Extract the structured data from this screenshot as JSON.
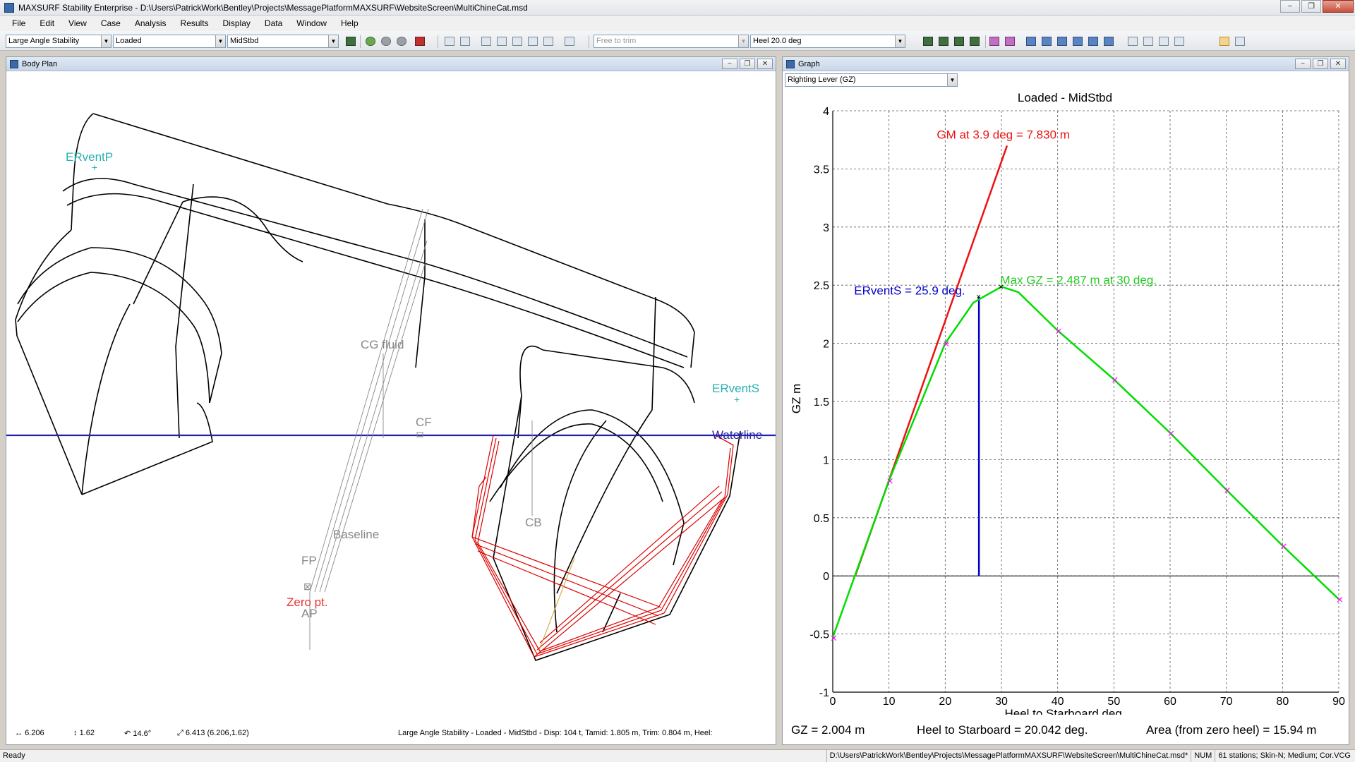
{
  "window": {
    "title": "MAXSURF Stability Enterprise - D:\\Users\\PatrickWork\\Bentley\\Projects\\MessagePlatformMAXSURF\\WebsiteScreen\\MultiChineCat.msd",
    "minimize": "−",
    "maximize": "❐",
    "close": "✕"
  },
  "menu": [
    "File",
    "Edit",
    "View",
    "Case",
    "Analysis",
    "Results",
    "Display",
    "Data",
    "Window",
    "Help"
  ],
  "toolbar": {
    "analysis_type": "Large Angle Stability",
    "loadcase": "Loaded",
    "fluid_mode": "MidStbd",
    "trim_mode": "Free to trim",
    "heel": "Heel 20.0 deg"
  },
  "body_plan": {
    "title": "Body Plan",
    "labels": {
      "ervent_p": "ERventP",
      "ervent_s": "ERventS",
      "cg_fluid": "CG fluid",
      "cf": "CF",
      "waterline": "Waterline",
      "cb": "CB",
      "baseline": "Baseline",
      "fp": "FP",
      "zero_pt": "Zero pt.",
      "ap": "AP"
    },
    "status": {
      "width": "6.206",
      "height": "1.62",
      "angle": "14.6°",
      "diag": "6.413 (6.206,1.62)",
      "summary": "Large Angle Stability - Loaded - MidStbd - Disp: 104 t, Tamid: 1.805 m, Trim: 0.804 m, Heel:"
    }
  },
  "graph": {
    "title": "Graph",
    "selector": "Righting Lever (GZ)",
    "readout": {
      "gz": "GZ =  2.004 m",
      "heel": "Heel to Starboard =  20.042  deg.",
      "area": "Area (from zero heel) =     15.94 m"
    }
  },
  "chart_data": {
    "type": "line",
    "title": "Loaded - MidStbd",
    "xlabel": "Heel to Starboard  deg.",
    "ylabel": "GZ  m",
    "xlim": [
      0,
      90
    ],
    "ylim": [
      -1,
      4
    ],
    "grid": true,
    "x_ticks": [
      0,
      10,
      20,
      30,
      40,
      50,
      60,
      70,
      80,
      90
    ],
    "y_ticks": [
      -1,
      -0.5,
      0,
      0.5,
      1,
      1.5,
      2,
      2.5,
      3,
      3.5,
      4
    ],
    "series": [
      {
        "color": "#00dd00",
        "x": [
          0,
          10,
          20,
          25,
          30,
          33,
          40,
          50,
          60,
          70,
          80,
          90
        ],
        "y": [
          -0.53,
          0.82,
          2.0,
          2.35,
          2.487,
          2.44,
          2.11,
          1.69,
          1.23,
          0.74,
          0.26,
          -0.2
        ]
      }
    ],
    "markers": {
      "color": "#ff00ff",
      "x": [
        0,
        10,
        20,
        40,
        50,
        60,
        70,
        80,
        90
      ],
      "y": [
        -0.53,
        0.82,
        2.0,
        2.11,
        1.69,
        1.23,
        0.74,
        0.26,
        -0.2
      ]
    },
    "gm_line": {
      "x": [
        4.0,
        31.0
      ],
      "y": [
        0,
        3.7
      ],
      "color": "#ee1111"
    },
    "ervent_line": {
      "x": 26.0,
      "y": [
        0,
        2.4
      ],
      "color": "#0000cc"
    },
    "annotations": [
      {
        "text": "GM at 3.9 deg = 7.830 m",
        "x": 18.5,
        "y": 3.76,
        "color": "#ee1111"
      },
      {
        "text": "ERventS = 25.9 deg.",
        "x": 3.8,
        "y": 2.42,
        "color": "#0000cc"
      },
      {
        "text": "Max GZ = 2.487 m at 30 deg.",
        "x": 29.8,
        "y": 2.51,
        "color": "#22cc22"
      }
    ]
  },
  "statusbar": {
    "left": "Ready",
    "path": "D:\\Users\\PatrickWork\\Bentley\\Projects\\MessagePlatformMAXSURF\\WebsiteScreen\\MultiChineCat.msd*",
    "num": "NUM",
    "info": "61 stations; Skin-N; Medium; Cor.VCG"
  }
}
